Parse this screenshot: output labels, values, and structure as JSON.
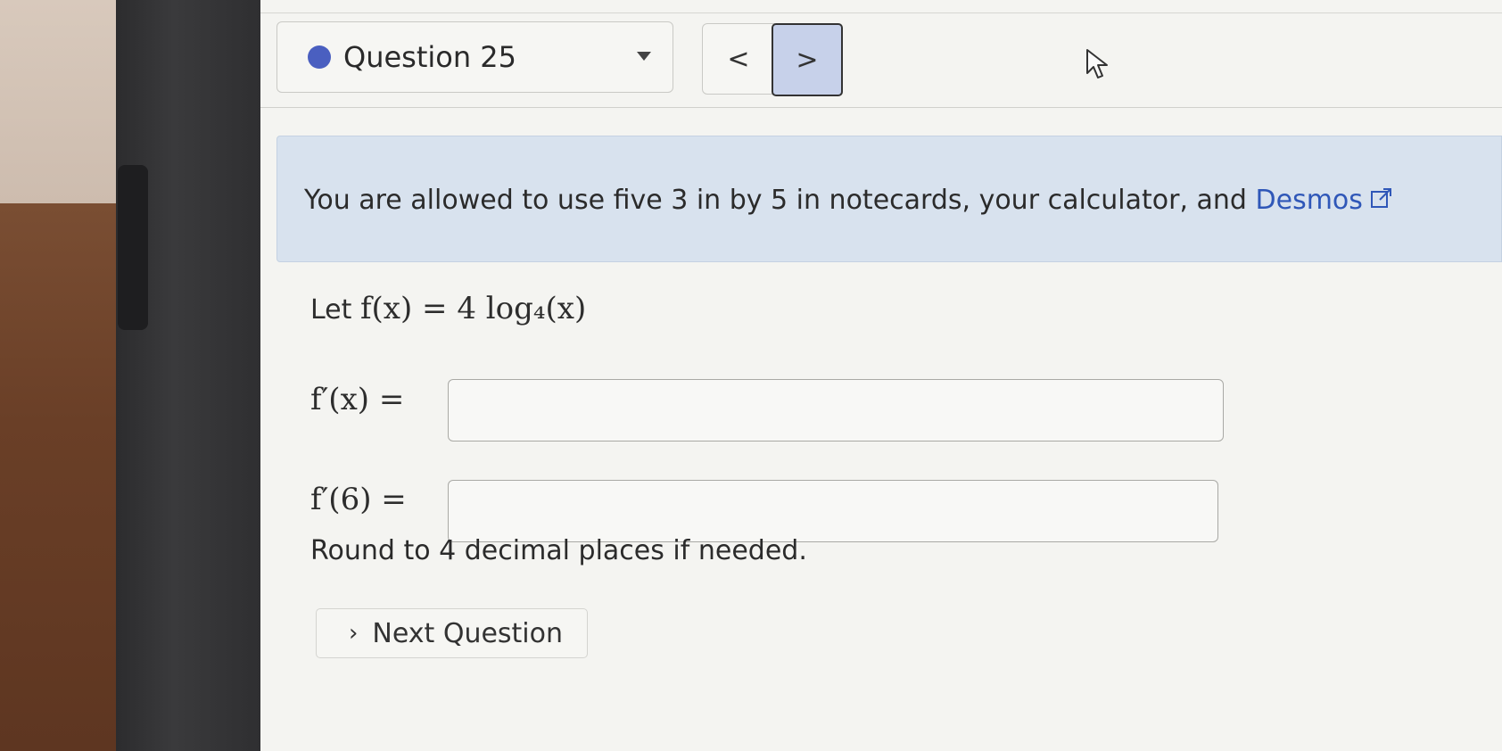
{
  "header": {
    "question_label": "Question 25",
    "prev_symbol": "<",
    "next_symbol": ">"
  },
  "info": {
    "text": "You are allowed to use five 3 in by 5 in notecards, your calculator, and ",
    "link_text": "Desmos"
  },
  "problem": {
    "let_prefix": "Let ",
    "function_def": "f(x) = 4 log₄(x)",
    "derivative_label": "f′(x) =",
    "derivative_at_label": "f′(6) =",
    "derivative_value": "",
    "derivative_at_value": "",
    "round_note": "Round to 4 decimal places if needed."
  },
  "footer": {
    "next_question_label": "Next Question"
  },
  "colors": {
    "accent": "#4a5fc0",
    "link": "#2f57b8",
    "info_bg": "#d8e2ee"
  }
}
